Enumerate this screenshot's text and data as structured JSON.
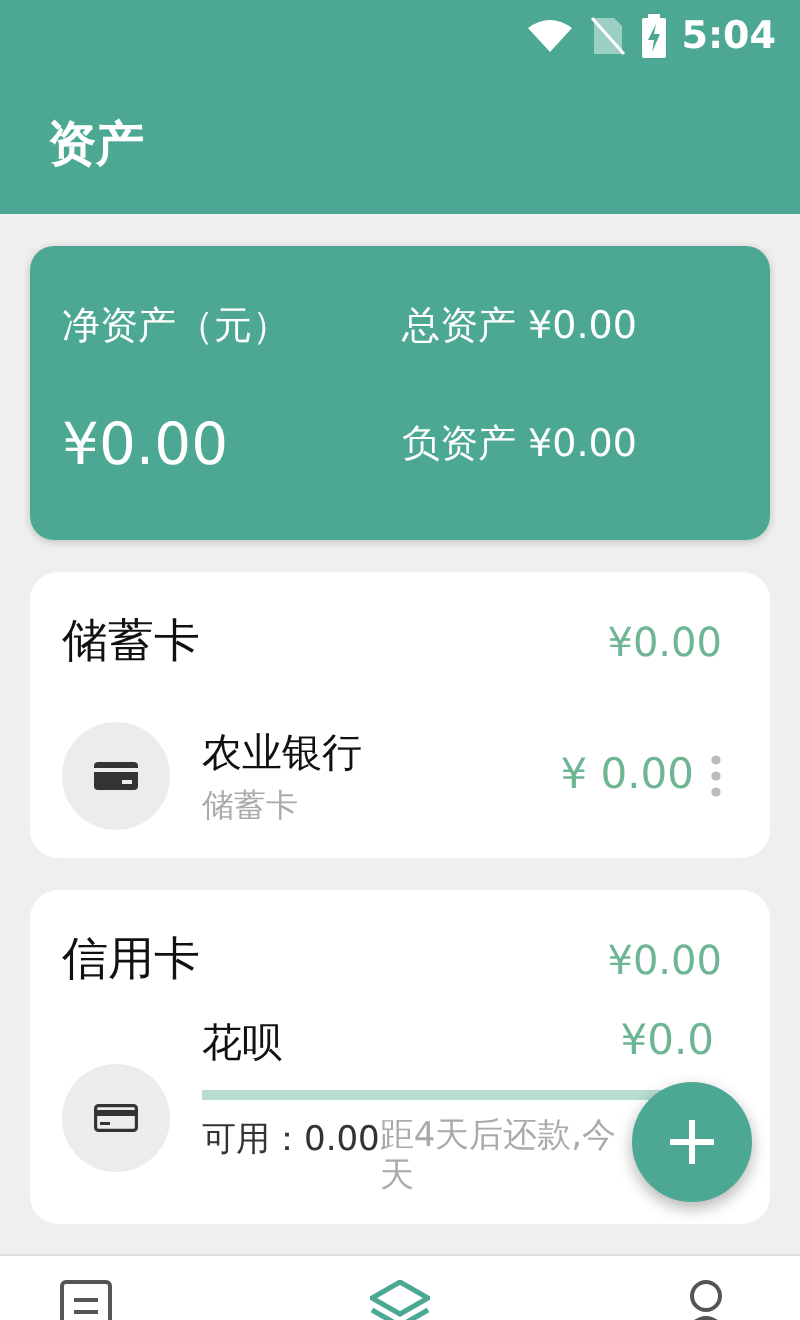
{
  "status_bar": {
    "time": "5:04"
  },
  "app_bar": {
    "title": "资产"
  },
  "summary": {
    "net_label": "净资产（元）",
    "net_value": "¥0.00",
    "total": "总资产 ¥0.00",
    "liabilities": "负资产 ¥0.00"
  },
  "groups": [
    {
      "title": "储蓄卡",
      "total": "¥0.00",
      "kind": "debit",
      "accounts": [
        {
          "name": "农业银行",
          "type": "储蓄卡",
          "balance": "¥ 0.00"
        }
      ]
    },
    {
      "title": "信用卡",
      "total": "¥0.00",
      "kind": "credit",
      "accounts": [
        {
          "name": "花呗",
          "balance": "¥0.0",
          "level": 1,
          "available": "可用：0.00",
          "remark_lines": [
            "距4天后还款,今",
            "天"
          ]
        }
      ]
    }
  ],
  "bottom_nav": [
    {
      "kind": "list",
      "selected": false
    },
    {
      "kind": "layers",
      "selected": true
    },
    {
      "kind": "person",
      "selected": false
    }
  ]
}
